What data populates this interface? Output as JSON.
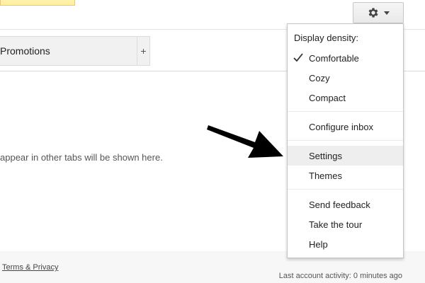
{
  "toolbar": {
    "gear_icon": "gear-icon",
    "dropdown_icon": "chevron-down-icon"
  },
  "tabs": {
    "items": [
      {
        "label": "Promotions"
      }
    ],
    "add_label": "+"
  },
  "main": {
    "empty_message": "appear in other tabs will be shown here."
  },
  "footer": {
    "terms_link": "Terms & Privacy",
    "last_activity": "Last account activity: 0 minutes ago"
  },
  "settings_menu": {
    "density_heading": "Display density:",
    "density_options": [
      {
        "label": "Comfortable",
        "checked": true
      },
      {
        "label": "Cozy",
        "checked": false
      },
      {
        "label": "Compact",
        "checked": false
      }
    ],
    "configure_inbox": "Configure inbox",
    "settings": "Settings",
    "themes": "Themes",
    "send_feedback": "Send feedback",
    "take_tour": "Take the tour",
    "help": "Help",
    "highlighted_item": "Settings"
  },
  "colors": {
    "notice_bg": "#fff1a8",
    "menu_highlight": "#eeeeee",
    "arrow": "#000000"
  }
}
